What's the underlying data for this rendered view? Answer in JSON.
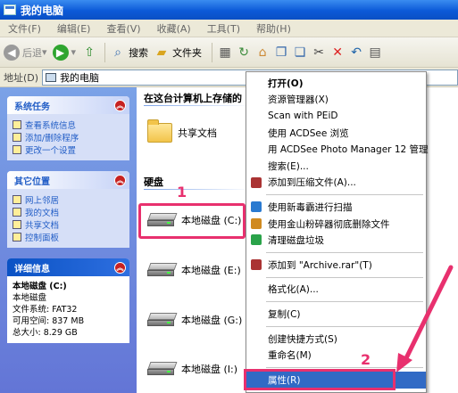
{
  "window": {
    "title": "我的电脑"
  },
  "menubar": {
    "items": [
      "文件(F)",
      "编辑(E)",
      "查看(V)",
      "收藏(A)",
      "工具(T)",
      "帮助(H)"
    ]
  },
  "toolbar": {
    "back": "后退",
    "search": "搜索",
    "folders": "文件夹"
  },
  "address": {
    "label": "地址(D)",
    "value": "我的电脑"
  },
  "left_panels": {
    "system_tasks": {
      "title": "系统任务",
      "items": [
        "查看系统信息",
        "添加/删除程序",
        "更改一个设置"
      ]
    },
    "other_places": {
      "title": "其它位置",
      "items": [
        "网上邻居",
        "我的文档",
        "共享文档",
        "控制面板"
      ]
    },
    "details": {
      "title": "详细信息",
      "lines": [
        "本地磁盘 (C:)",
        "本地磁盘",
        "文件系统: FAT32",
        "可用空间: 837 MB",
        "总大小: 8.29 GB"
      ]
    }
  },
  "main": {
    "header": "在这台计算机上存储的",
    "shared_folder": "共享文档",
    "hdd_header": "硬盘",
    "drives": [
      "本地磁盘 (C:)",
      "本地磁盘 (E:)",
      "本地磁盘 (G:)",
      "本地磁盘 (I:)"
    ]
  },
  "context_menu": {
    "items": [
      "打开(O)",
      "资源管理器(X)",
      "Scan with PEiD",
      "使用 ACDSee 浏览",
      "用 ACDSee Photo Manager 12 管理",
      "搜索(E)...",
      "添加到压缩文件(A)...",
      "使用新毒霸进行扫描",
      "使用金山粉碎器彻底删除文件",
      "清理磁盘垃圾",
      "添加到 \"Archive.rar\"(T)",
      "格式化(A)...",
      "复制(C)",
      "创建快捷方式(S)",
      "重命名(M)",
      "属性(R)"
    ]
  },
  "annotations": {
    "step1": "1",
    "step2": "2"
  },
  "colors": {
    "annotation": "#e8306e",
    "xp_blue": "#0c5ad8",
    "menu_highlight": "#316ac5"
  }
}
